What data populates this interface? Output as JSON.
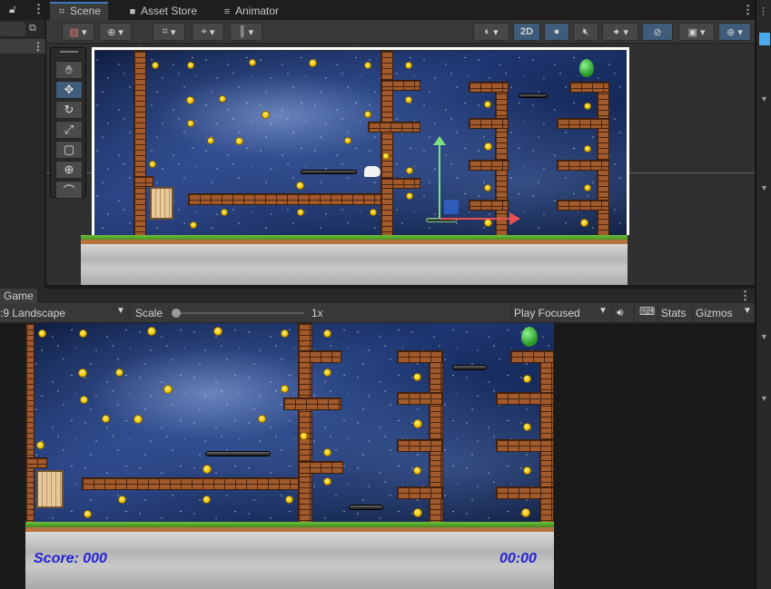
{
  "scene_tabs": [
    {
      "label": "Scene",
      "icon": "grid-icon"
    },
    {
      "label": "Asset Store",
      "icon": "bag-icon"
    },
    {
      "label": "Animator",
      "icon": "animator-icon"
    }
  ],
  "scene_toolbar": {
    "mode_2d_label": "2D"
  },
  "game_tab": {
    "label": "Game"
  },
  "game_toolbar": {
    "aspect_value": ":9 Landscape",
    "scale_label": "Scale",
    "scale_value": "1x",
    "scale_fraction": 0.0,
    "play_mode_value": "Play Focused",
    "stats_label": "Stats",
    "gizmos_label": "Gizmos"
  },
  "game_hud": {
    "score_text": "Score: 000",
    "timer_text": "00:00",
    "hud_color": "#2323d6"
  },
  "colors": {
    "accent": "#3a79bb",
    "panel": "#383838",
    "background": "#191919"
  },
  "icons": {
    "hand_tool": "hand-icon",
    "move_tool": "move-icon",
    "rotate_tool": "rotate-icon",
    "scale_tool": "scale-icon",
    "rect_tool": "rect-icon",
    "transform_tool": "transform-icon",
    "custom_tool": "custom-tool-icon"
  }
}
